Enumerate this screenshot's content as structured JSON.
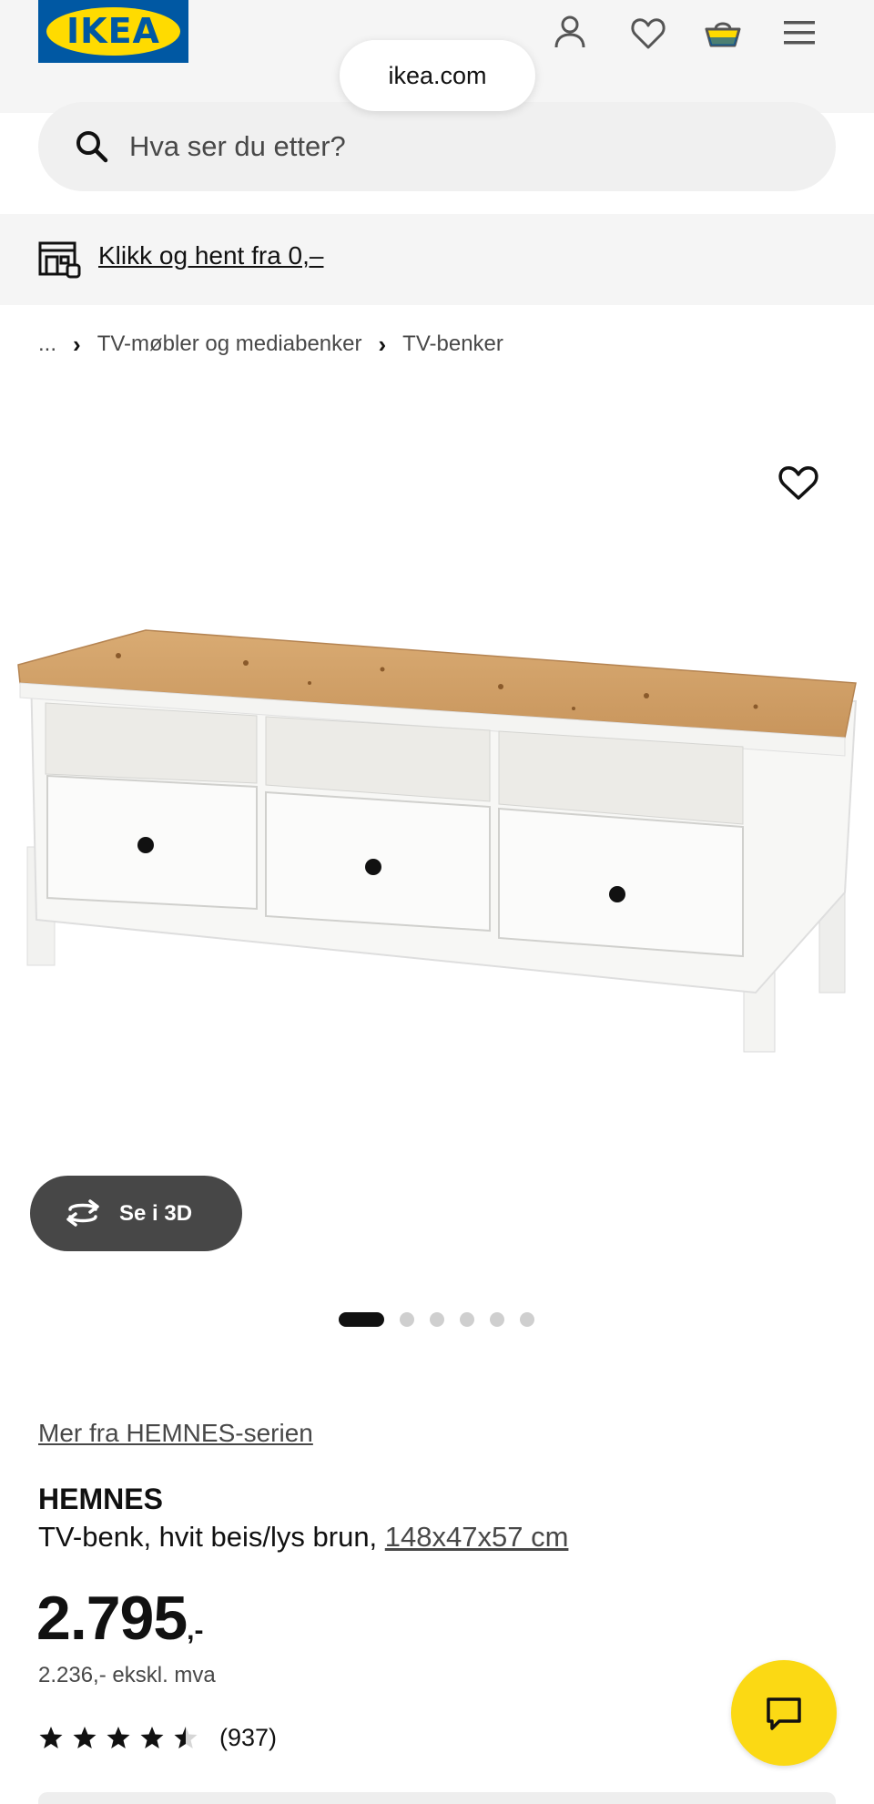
{
  "header": {
    "logo_text": "IKEA",
    "url": "ikea.com",
    "icons": [
      "user-icon",
      "heart-icon",
      "basket-icon",
      "hamburger-menu-icon"
    ]
  },
  "search": {
    "placeholder": "Hva ser du etter?"
  },
  "banner": {
    "link_text": "Klikk og hent fra 0,–"
  },
  "breadcrumb": {
    "items": [
      "...",
      "TV-møbler og mediabenker",
      "TV-benker"
    ]
  },
  "gallery": {
    "button_3d": "Se i 3D",
    "total_images": 6,
    "active_image": 1
  },
  "product": {
    "series_link": "Mer fra HEMNES-serien",
    "name": "HEMNES",
    "description": "TV-benk, hvit beis/lys brun, ",
    "dimensions": "148x47x57 cm",
    "price_main": "2.795",
    "price_suffix": ",-",
    "price_ex_vat": "2.236,- ekskl. mva",
    "rating_value": 4.5,
    "rating_max": 5,
    "review_count": "(937)"
  },
  "colors": {
    "brand_blue": "#0058a3",
    "brand_yellow": "#ffdb00",
    "chat_yellow": "#fbd914",
    "button_3d_bg": "#474747"
  }
}
